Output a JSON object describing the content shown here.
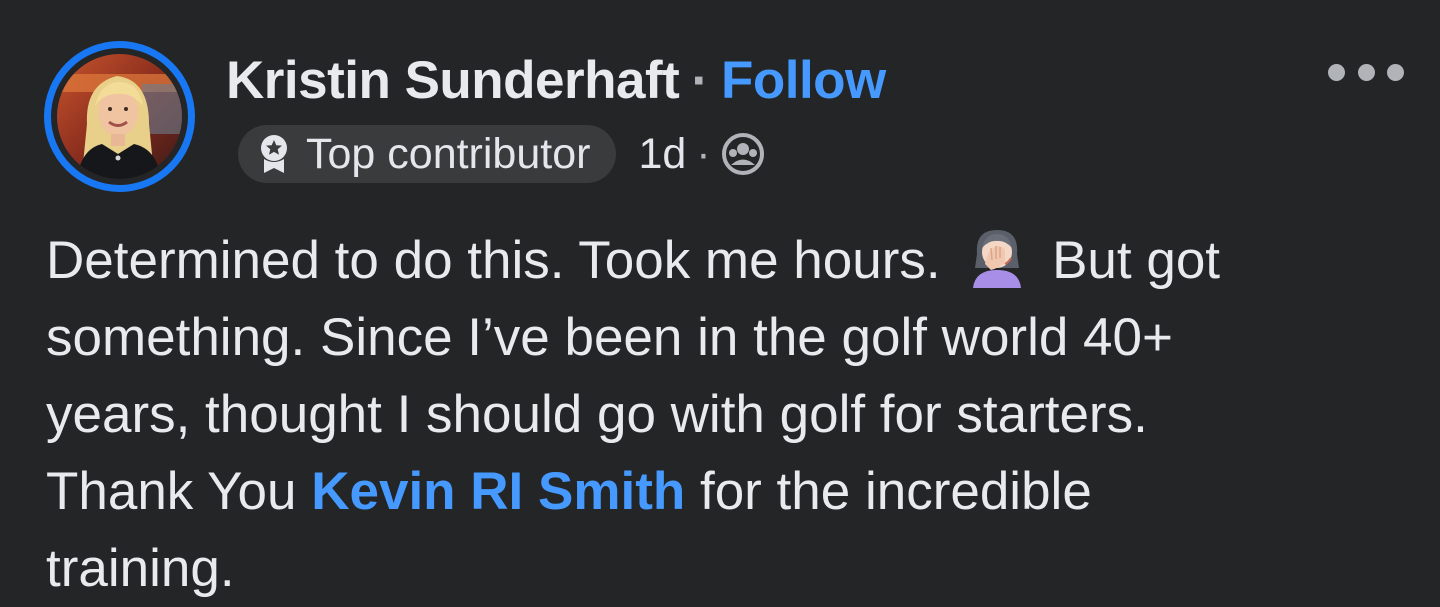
{
  "post": {
    "author": {
      "name": "Kristin Sunderhaft",
      "follow_label": "Follow",
      "separator": "·"
    },
    "meta": {
      "badge_label": "Top contributor",
      "time": "1d",
      "separator": "·",
      "audience_icon": "group-audience-icon"
    },
    "more_icon": "more-options-icon",
    "body": {
      "line1_before": "Determined to do this. Took me hours.",
      "emoji": "🤦‍♀️",
      "line1_after": "But got",
      "line2": "something. Since I’ve been in the golf world 40+",
      "line3": "years, thought I should go with golf for starters.",
      "line4_before": "Thank You ",
      "mention": "Kevin RI Smith",
      "line4_after": " for the incredible",
      "line5": "training."
    }
  },
  "colors": {
    "background": "#242527",
    "link": "#4599ff",
    "avatar_ring": "#1877f2",
    "badge_bg": "#3a3b3c",
    "text": "#e8eaed",
    "muted": "#b0b3b8"
  }
}
